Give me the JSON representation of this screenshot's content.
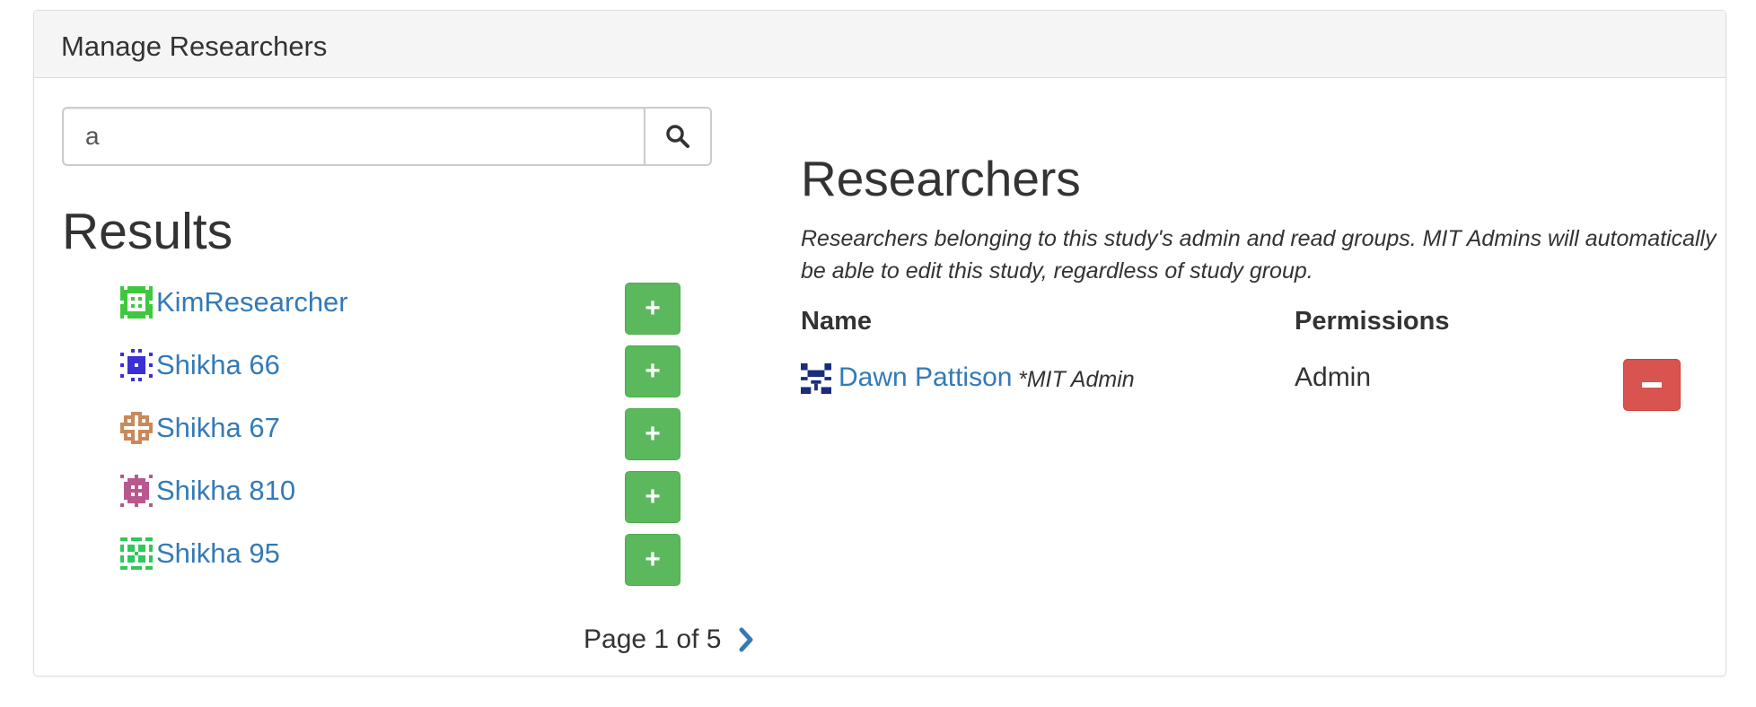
{
  "panel": {
    "title": "Manage Researchers"
  },
  "search": {
    "value": "a",
    "button_icon": "search-icon"
  },
  "results": {
    "title": "Results",
    "items": [
      {
        "label": "KimResearcher",
        "avatar_color": "#3ec83e",
        "add_label": "+"
      },
      {
        "label": "Shikha 66",
        "avatar_color": "#3b2fd6",
        "add_label": "+"
      },
      {
        "label": "Shikha 67",
        "avatar_color": "#c9895a",
        "add_label": "+"
      },
      {
        "label": "Shikha 810",
        "avatar_color": "#b8588f",
        "add_label": "+"
      },
      {
        "label": "Shikha 95",
        "avatar_color": "#2ec95a",
        "add_label": "+"
      }
    ],
    "pager": {
      "text": "Page 1 of 5",
      "next_icon": "chevron-right-icon"
    }
  },
  "researchers": {
    "title": "Researchers",
    "description": "Researchers belonging to this study's admin and read groups. MIT Admins will automatically be able to edit this study, regardless of study group.",
    "columns": {
      "name": "Name",
      "permissions": "Permissions"
    },
    "members": [
      {
        "name": "Dawn Pattison",
        "note": "*MIT Admin",
        "permission": "Admin",
        "avatar_color": "#1a2c7a",
        "remove_icon": "minus-icon"
      }
    ]
  },
  "colors": {
    "link": "#337ab7",
    "success": "#5cb85c",
    "danger": "#d9534f"
  }
}
